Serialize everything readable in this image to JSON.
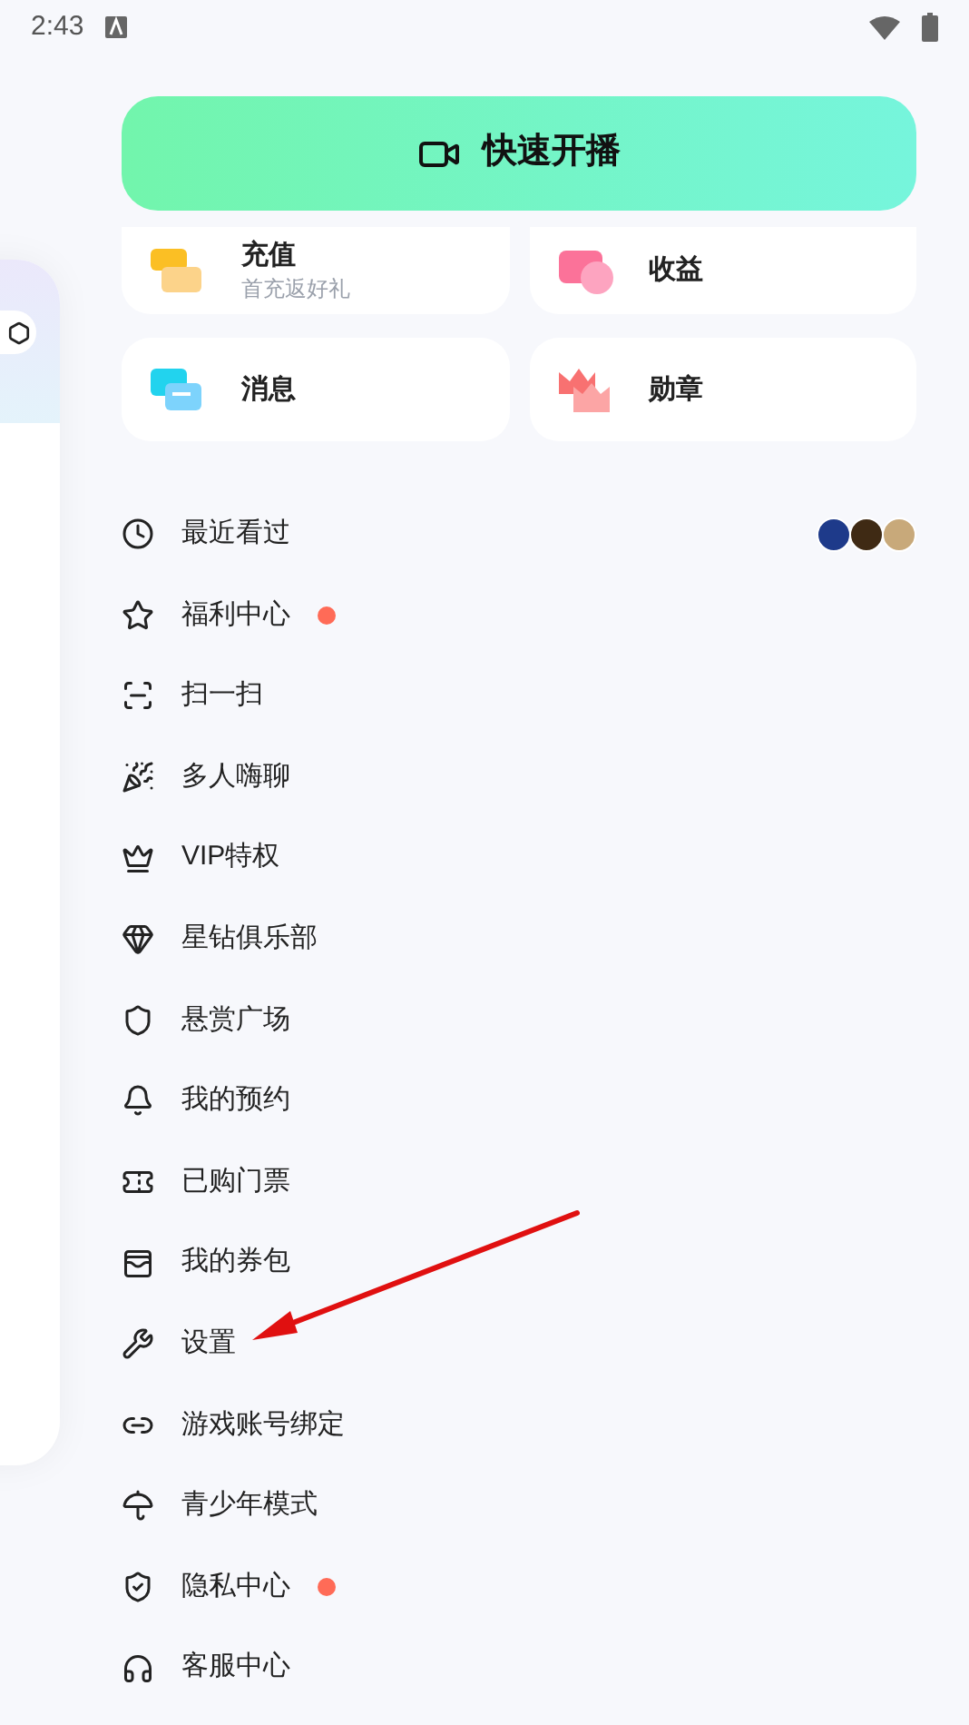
{
  "status_bar": {
    "time": "2:43"
  },
  "live_button": {
    "label": "快速开播"
  },
  "shortcuts": [
    {
      "title": "充值",
      "subtitle": "首充返好礼"
    },
    {
      "title": "收益"
    },
    {
      "title": "消息"
    },
    {
      "title": "勋章"
    }
  ],
  "menu": [
    {
      "label": "最近看过",
      "kind": "recent",
      "dot": false
    },
    {
      "label": "福利中心",
      "kind": "plain",
      "dot": true
    },
    {
      "label": "扫一扫",
      "kind": "plain",
      "dot": false
    },
    {
      "label": "多人嗨聊",
      "kind": "plain",
      "dot": false
    },
    {
      "label": "VIP特权",
      "kind": "plain",
      "dot": false
    },
    {
      "label": "星钻俱乐部",
      "kind": "plain",
      "dot": false
    },
    {
      "label": "悬赏广场",
      "kind": "plain",
      "dot": false
    },
    {
      "label": "我的预约",
      "kind": "plain",
      "dot": false
    },
    {
      "label": "已购门票",
      "kind": "plain",
      "dot": false
    },
    {
      "label": "我的券包",
      "kind": "plain",
      "dot": false
    },
    {
      "label": "设置",
      "kind": "plain",
      "dot": false
    },
    {
      "label": "游戏账号绑定",
      "kind": "plain",
      "dot": false
    },
    {
      "label": "青少年模式",
      "kind": "plain",
      "dot": false
    },
    {
      "label": "隐私中心",
      "kind": "plain",
      "dot": true
    },
    {
      "label": "客服中心",
      "kind": "plain",
      "dot": false
    }
  ]
}
